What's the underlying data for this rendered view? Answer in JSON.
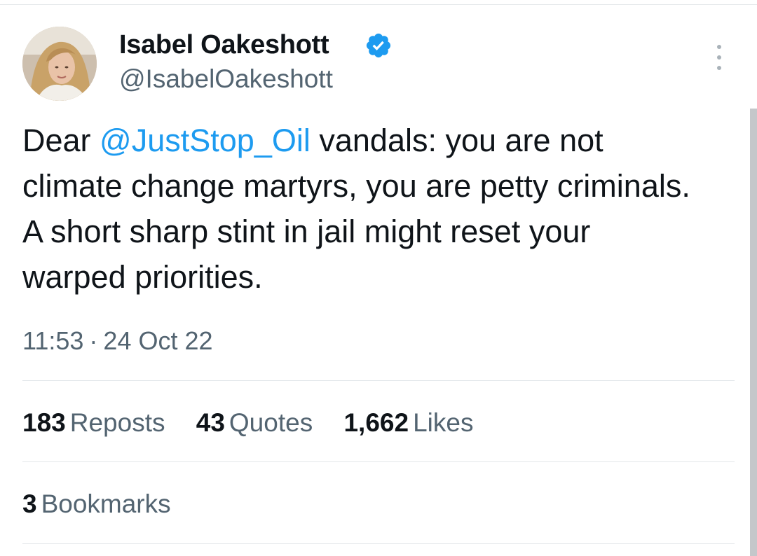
{
  "author": {
    "name": "Isabel Oakeshott",
    "handle": "@IsabelOakeshott",
    "verified": true,
    "verified_color": "#1d9bf0"
  },
  "tweet": {
    "text_before_mention": "Dear ",
    "mention": "@JustStop_Oil",
    "text_after_mention": " vandals: you are not climate change martyrs, you are petty criminals. A short sharp stint in jail might reset your warped priorities.",
    "time": "11:53",
    "separator": "·",
    "date": "24 Oct 22",
    "mention_color": "#1d9bf0"
  },
  "stats": {
    "reposts": {
      "count": "183",
      "label": "Reposts"
    },
    "quotes": {
      "count": "43",
      "label": "Quotes"
    },
    "likes": {
      "count": "1,662",
      "label": "Likes"
    },
    "bookmarks": {
      "count": "3",
      "label": "Bookmarks"
    }
  },
  "icons": {
    "verified": "verified-badge-icon",
    "more": "more-options-icon"
  }
}
